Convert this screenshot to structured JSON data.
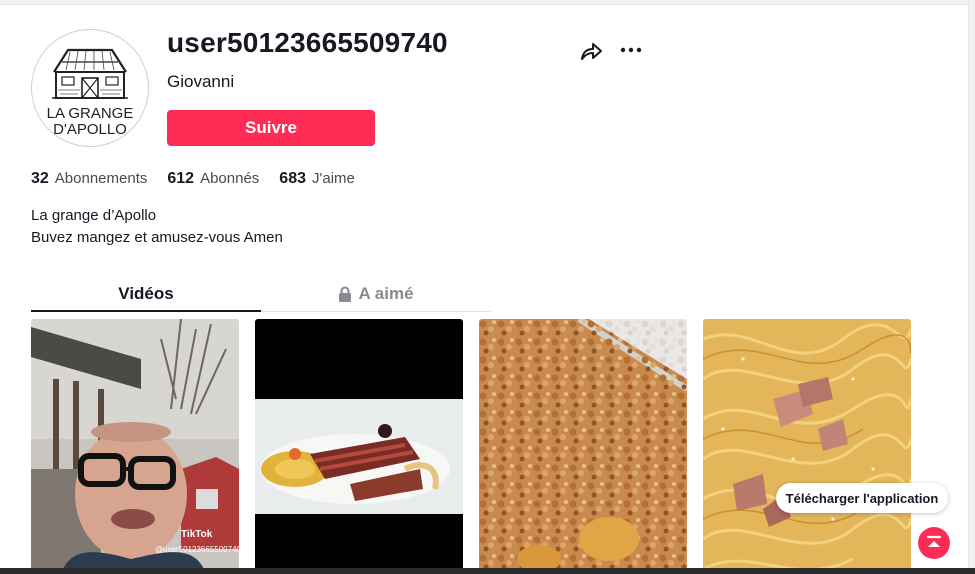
{
  "profile": {
    "username": "user50123665509740",
    "nickname": "Giovanni",
    "follow_label": "Suivre",
    "avatar_logo_text_line1": "LA GRANGE",
    "avatar_logo_text_line2": "D'APOLLO"
  },
  "stats": [
    {
      "value": "32",
      "label": "Abonnements"
    },
    {
      "value": "612",
      "label": "Abonnés"
    },
    {
      "value": "683",
      "label": "J'aime"
    }
  ],
  "bio": {
    "line1": "La grange d’Apollo",
    "line2": "Buvez mangez et amusez-vous Amen"
  },
  "tabs": {
    "videos": "Vidéos",
    "liked": "A aimé"
  },
  "videos": [
    {
      "watermark": "TikTok",
      "handle": "@user50123665509740"
    },
    {},
    {},
    {}
  ],
  "floating": {
    "download_label": "Télécharger l'application"
  },
  "icons": {
    "share": "share-icon",
    "more": "more-icon",
    "lock": "lock-icon",
    "scroll_top": "scroll-top-icon"
  },
  "colors": {
    "accent": "#fe2c55",
    "text": "#161823",
    "muted": "#8a8b91"
  }
}
